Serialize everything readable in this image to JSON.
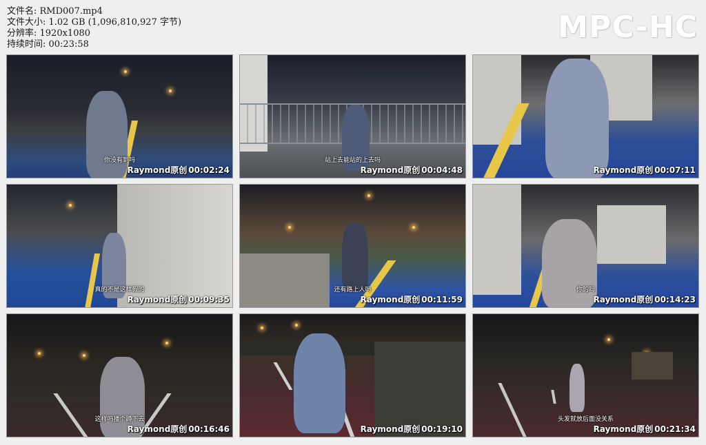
{
  "file_info": {
    "filename": "文件名: RMD007.mp4",
    "filesize": "文件大小: 1.02 GB (1,096,810,927 字节)",
    "resolution": "分辨率: 1920x1080",
    "duration": "持续时间: 00:23:58"
  },
  "logo": "MPC-HC",
  "watermark": "Raymond原创",
  "thumbnails": [
    {
      "subtitle": "你没有到吗",
      "timestamp": "00:02:24"
    },
    {
      "subtitle": "站上去能站的上去吗",
      "timestamp": "00:04:48"
    },
    {
      "subtitle": "",
      "timestamp": "00:07:11"
    },
    {
      "subtitle": "真的不是这样假的",
      "timestamp": "00:09:35"
    },
    {
      "subtitle": "还有路上人吗",
      "timestamp": "00:11:59"
    },
    {
      "subtitle": "你的吗",
      "timestamp": "00:14:23"
    },
    {
      "subtitle": "这样吗搂个蹲下去",
      "timestamp": "00:16:46"
    },
    {
      "subtitle": "",
      "timestamp": "00:19:10"
    },
    {
      "subtitle": "头发就放后面没关系",
      "timestamp": "00:21:34"
    }
  ]
}
